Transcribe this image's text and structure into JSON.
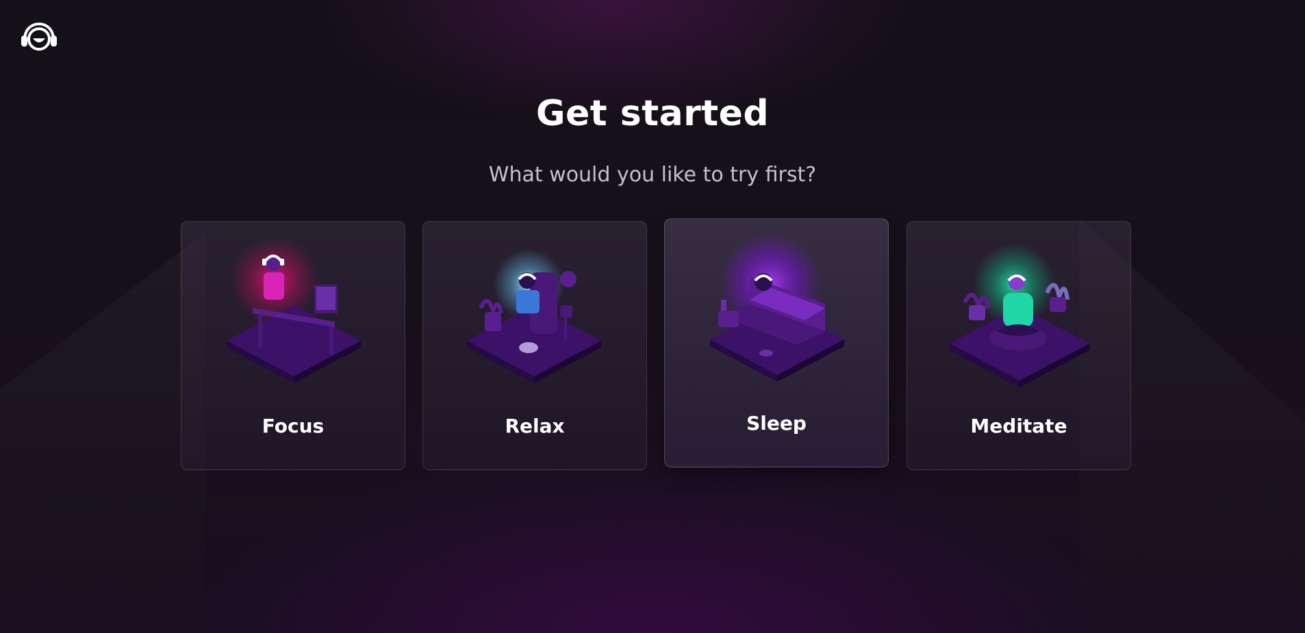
{
  "header": {
    "logo_icon": "headphones-face-logo-icon",
    "title": "Get started",
    "subtitle": "What would you like to try first?"
  },
  "options": [
    {
      "label": "Focus",
      "glow_color": "#e0156e",
      "icon": "person-at-desk-illustration"
    },
    {
      "label": "Relax",
      "glow_color": "#5fb8e8",
      "icon": "person-on-couch-illustration"
    },
    {
      "label": "Sleep",
      "glow_color": "#8a16e0",
      "icon": "person-in-bed-illustration"
    },
    {
      "label": "Meditate",
      "glow_color": "#17c98a",
      "icon": "person-meditating-illustration"
    }
  ],
  "accent": "#7b2cbf"
}
